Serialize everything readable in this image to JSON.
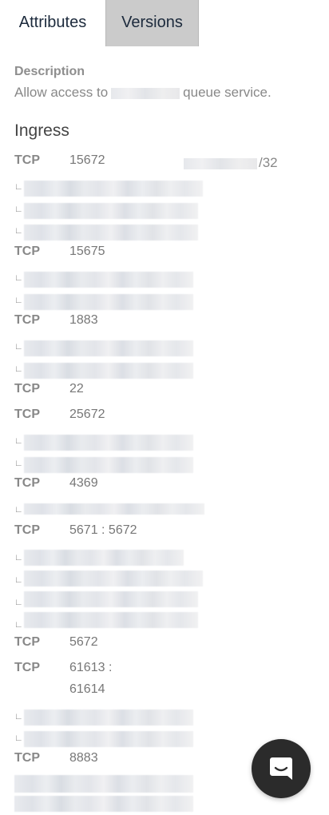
{
  "tabs": [
    {
      "label": "Attributes",
      "active": true
    },
    {
      "label": "Versions",
      "active": false
    }
  ],
  "description": {
    "label": "Description",
    "prefix": "Allow access to",
    "suffix": "queue service."
  },
  "ingress": {
    "title": "Ingress",
    "cidr_suffix": "/32",
    "rules": [
      {
        "protocol": "TCP",
        "port": "15672"
      },
      {
        "protocol": "TCP",
        "port": "15675"
      },
      {
        "protocol": "TCP",
        "port": "1883"
      },
      {
        "protocol": "TCP",
        "port": "22"
      },
      {
        "protocol": "TCP",
        "port": "25672"
      },
      {
        "protocol": "TCP",
        "port": "4369"
      },
      {
        "protocol": "TCP",
        "port": "5671 : 5672"
      },
      {
        "protocol": "TCP",
        "port": "5672"
      },
      {
        "protocol": "TCP",
        "port": "61613 :",
        "port_line2": "61614"
      },
      {
        "protocol": "TCP",
        "port": "8883"
      }
    ]
  },
  "chat": {
    "icon": "chat-bubble-icon"
  }
}
